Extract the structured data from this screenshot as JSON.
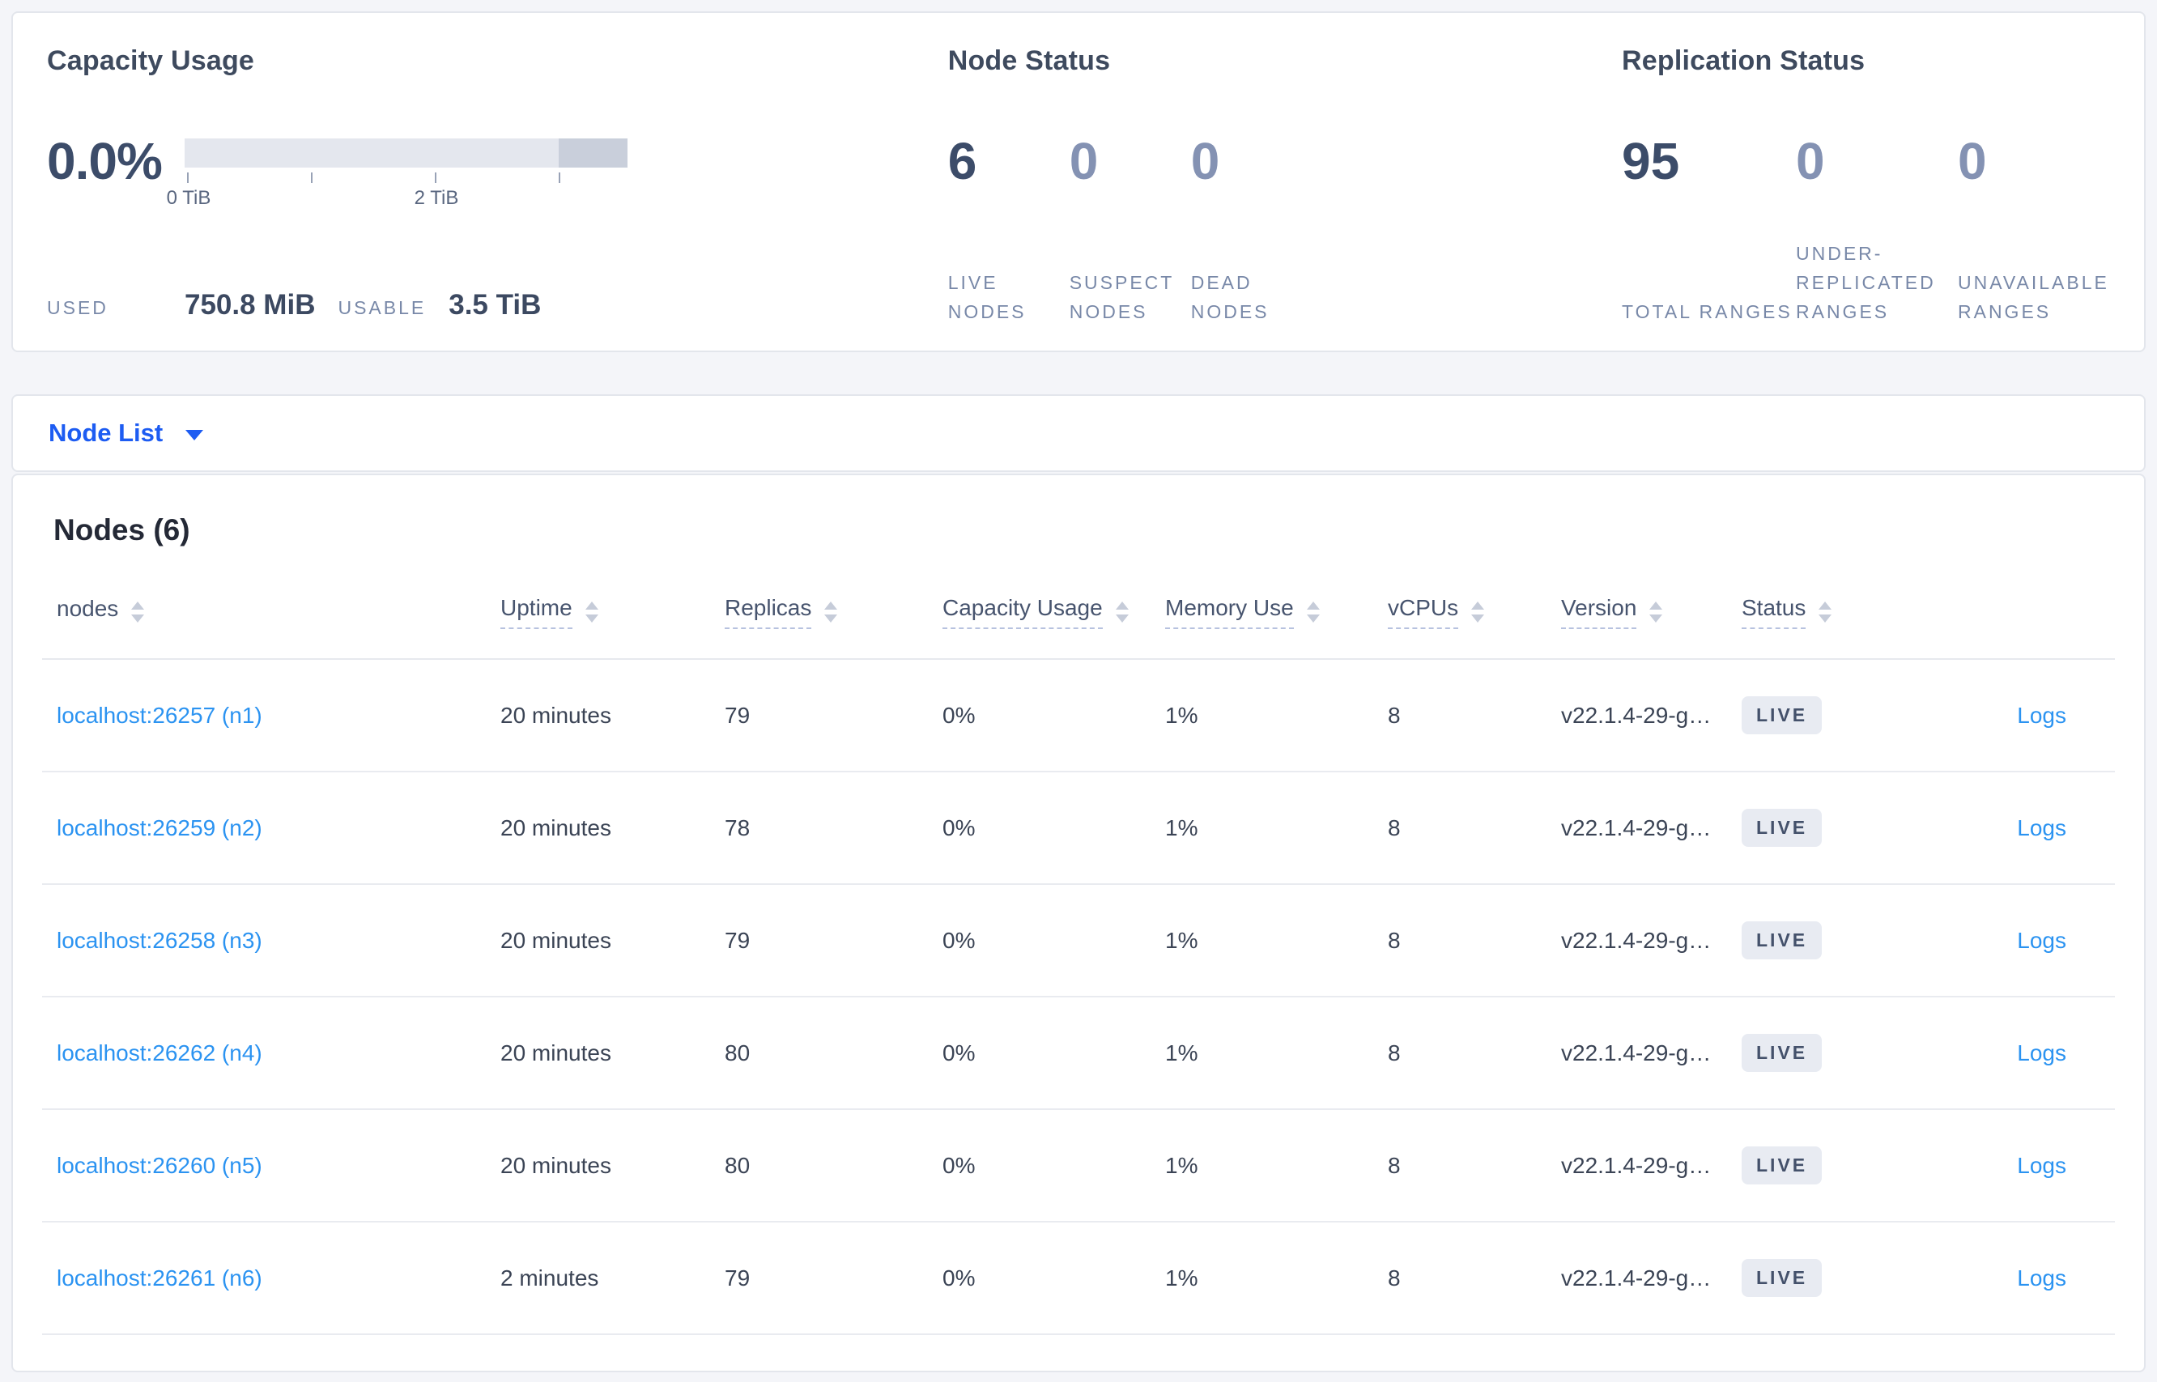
{
  "capacity_usage": {
    "title": "Capacity Usage",
    "percent": "0.0%",
    "axis_ticks": [
      "0 TiB",
      "2 TiB"
    ],
    "used_label": "USED",
    "used_value": "750.8 MiB",
    "usable_label": "USABLE",
    "usable_value": "3.5 TiB"
  },
  "node_status": {
    "title": "Node Status",
    "stats": [
      {
        "value": "6",
        "label": "LIVE NODES"
      },
      {
        "value": "0",
        "label": "SUSPECT NODES"
      },
      {
        "value": "0",
        "label": "DEAD NODES"
      }
    ]
  },
  "replication_status": {
    "title": "Replication Status",
    "stats": [
      {
        "value": "95",
        "label": "TOTAL RANGES"
      },
      {
        "value": "0",
        "label": "UNDER-REPLICATED RANGES"
      },
      {
        "value": "0",
        "label": "UNAVAILABLE RANGES"
      }
    ]
  },
  "view_selector": {
    "label": "Node List"
  },
  "nodes_table": {
    "title": "Nodes (6)",
    "columns": [
      "nodes",
      "Uptime",
      "Replicas",
      "Capacity Usage",
      "Memory Use",
      "vCPUs",
      "Version",
      "Status"
    ],
    "rows": [
      {
        "name": "localhost:26257 (n1)",
        "uptime": "20 minutes",
        "replicas": "79",
        "capacity": "0%",
        "memory": "1%",
        "vcpus": "8",
        "version": "v22.1.4-29-g…",
        "status": "LIVE",
        "logs": "Logs"
      },
      {
        "name": "localhost:26259 (n2)",
        "uptime": "20 minutes",
        "replicas": "78",
        "capacity": "0%",
        "memory": "1%",
        "vcpus": "8",
        "version": "v22.1.4-29-g…",
        "status": "LIVE",
        "logs": "Logs"
      },
      {
        "name": "localhost:26258 (n3)",
        "uptime": "20 minutes",
        "replicas": "79",
        "capacity": "0%",
        "memory": "1%",
        "vcpus": "8",
        "version": "v22.1.4-29-g…",
        "status": "LIVE",
        "logs": "Logs"
      },
      {
        "name": "localhost:26262 (n4)",
        "uptime": "20 minutes",
        "replicas": "80",
        "capacity": "0%",
        "memory": "1%",
        "vcpus": "8",
        "version": "v22.1.4-29-g…",
        "status": "LIVE",
        "logs": "Logs"
      },
      {
        "name": "localhost:26260 (n5)",
        "uptime": "20 minutes",
        "replicas": "80",
        "capacity": "0%",
        "memory": "1%",
        "vcpus": "8",
        "version": "v22.1.4-29-g…",
        "status": "LIVE",
        "logs": "Logs"
      },
      {
        "name": "localhost:26261 (n6)",
        "uptime": "2 minutes",
        "replicas": "79",
        "capacity": "0%",
        "memory": "1%",
        "vcpus": "8",
        "version": "v22.1.4-29-g…",
        "status": "LIVE",
        "logs": "Logs"
      }
    ]
  },
  "colors": {
    "selector_blue": "#1d5cf2",
    "link_blue": "#2b93f1",
    "live_badge_bg": "#e8ebf2",
    "gauge_track": "#e4e7ee",
    "gauge_used_segment": "#c9cfdb",
    "page_background": "#f4f5f9"
  }
}
